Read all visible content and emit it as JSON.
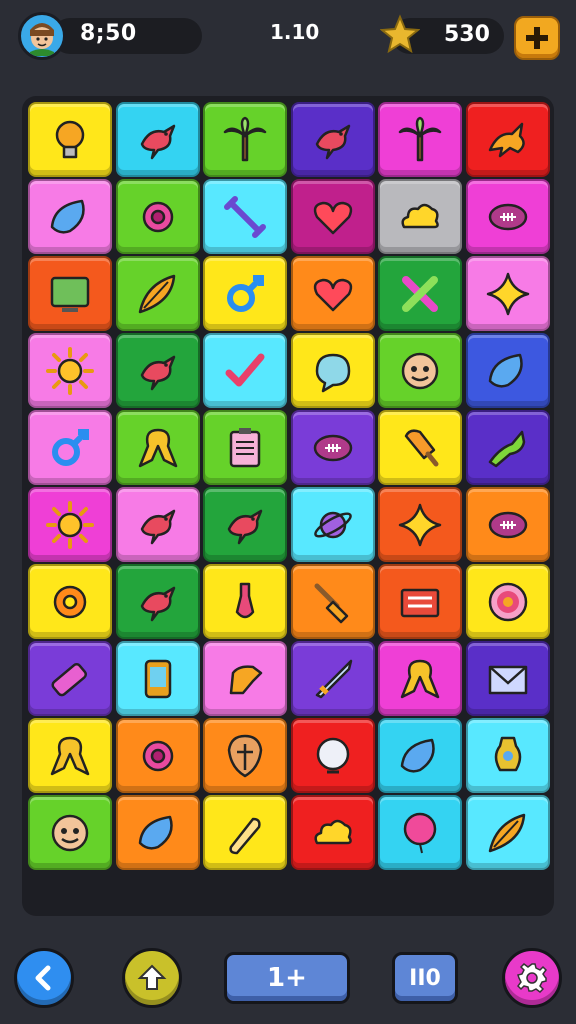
{
  "hud": {
    "timer": "8;50",
    "level": "1.10",
    "coins": "530"
  },
  "colors": {
    "yellow": "#ffe71a",
    "cyan": "#34d3f2",
    "green": "#66d22a",
    "purple": "#5a2fc8",
    "magenta": "#ef3fd6",
    "red": "#ef2020",
    "pink": "#f77be6",
    "lightcyan": "#58e8ff",
    "darkpink": "#c0208c",
    "gray": "#b9b9bd",
    "orange": "#ff8a1a",
    "darkgreen": "#23a53c",
    "violet": "#7a3cd8",
    "blue": "#3d58e0",
    "orangered": "#f4591d"
  },
  "tiles": [
    {
      "color": "yellow",
      "icon": "lightbulb-icon"
    },
    {
      "color": "cyan",
      "icon": "bird-icon"
    },
    {
      "color": "green",
      "icon": "palm-tree-icon"
    },
    {
      "color": "purple",
      "icon": "bird-icon"
    },
    {
      "color": "magenta",
      "icon": "palm-tree-icon"
    },
    {
      "color": "red",
      "icon": "dragon-icon"
    },
    {
      "color": "pink",
      "icon": "leaf-icon"
    },
    {
      "color": "green",
      "icon": "flower-icon"
    },
    {
      "color": "lightcyan",
      "icon": "wrench-icon"
    },
    {
      "color": "darkpink",
      "icon": "heart-icon"
    },
    {
      "color": "gray",
      "icon": "cloud-icon"
    },
    {
      "color": "magenta",
      "icon": "football-icon"
    },
    {
      "color": "orangered",
      "icon": "monitor-icon"
    },
    {
      "color": "green",
      "icon": "feather-icon"
    },
    {
      "color": "yellow",
      "icon": "male-symbol-icon"
    },
    {
      "color": "orange",
      "icon": "heart-icon"
    },
    {
      "color": "darkgreen",
      "icon": "tools-icon"
    },
    {
      "color": "pink",
      "icon": "star-icon"
    },
    {
      "color": "pink",
      "icon": "sun-icon"
    },
    {
      "color": "darkgreen",
      "icon": "bird-icon"
    },
    {
      "color": "lightcyan",
      "icon": "check-icon"
    },
    {
      "color": "yellow",
      "icon": "chat-bubble-icon"
    },
    {
      "color": "green",
      "icon": "face-icon"
    },
    {
      "color": "blue",
      "icon": "leaf-icon"
    },
    {
      "color": "pink",
      "icon": "male-symbol-icon"
    },
    {
      "color": "green",
      "icon": "ribbon-icon"
    },
    {
      "color": "green",
      "icon": "clipboard-icon"
    },
    {
      "color": "violet",
      "icon": "football-icon"
    },
    {
      "color": "yellow",
      "icon": "popsicle-icon"
    },
    {
      "color": "purple",
      "icon": "lizard-icon"
    },
    {
      "color": "magenta",
      "icon": "sun-icon"
    },
    {
      "color": "pink",
      "icon": "bird-icon"
    },
    {
      "color": "darkgreen",
      "icon": "bird-icon"
    },
    {
      "color": "lightcyan",
      "icon": "planet-icon"
    },
    {
      "color": "orangered",
      "icon": "star-icon"
    },
    {
      "color": "orange",
      "icon": "football-icon"
    },
    {
      "color": "yellow",
      "icon": "gear-icon"
    },
    {
      "color": "darkgreen",
      "icon": "bird-icon"
    },
    {
      "color": "yellow",
      "icon": "brush-icon"
    },
    {
      "color": "orange",
      "icon": "broom-icon"
    },
    {
      "color": "orangered",
      "icon": "book-icon"
    },
    {
      "color": "yellow",
      "icon": "lollipop-icon"
    },
    {
      "color": "violet",
      "icon": "battery-icon"
    },
    {
      "color": "lightcyan",
      "icon": "phone-icon"
    },
    {
      "color": "pink",
      "icon": "glove-icon"
    },
    {
      "color": "violet",
      "icon": "sword-icon"
    },
    {
      "color": "magenta",
      "icon": "ribbon-icon"
    },
    {
      "color": "purple",
      "icon": "envelope-icon"
    },
    {
      "color": "yellow",
      "icon": "ribbon-icon"
    },
    {
      "color": "orange",
      "icon": "flower-icon"
    },
    {
      "color": "orange",
      "icon": "shield-icon"
    },
    {
      "color": "red",
      "icon": "globe-icon"
    },
    {
      "color": "cyan",
      "icon": "leaf-icon"
    },
    {
      "color": "lightcyan",
      "icon": "vase-icon"
    },
    {
      "color": "green",
      "icon": "face-icon"
    },
    {
      "color": "orange",
      "icon": "leaf-icon"
    },
    {
      "color": "yellow",
      "icon": "scroll-icon"
    },
    {
      "color": "red",
      "icon": "cloud-icon"
    },
    {
      "color": "cyan",
      "icon": "balloon-icon"
    },
    {
      "color": "lightcyan",
      "icon": "feather-icon"
    }
  ],
  "bottom": {
    "hint_label": "1+",
    "pause_label": "II0"
  }
}
